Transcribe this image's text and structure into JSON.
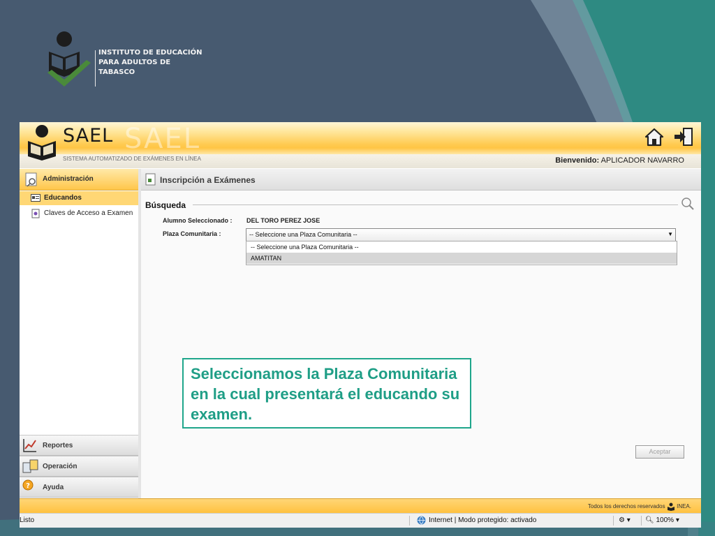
{
  "org": {
    "name_lines": [
      "INSTITUTO DE EDUCACIÓN",
      "PARA ADULTOS DE",
      "TABASCO"
    ]
  },
  "app": {
    "title": "SAEL",
    "subtitle": "SISTEMA AUTOMATIZADO DE EXÁMENES EN LÍNEA",
    "welcome_label": "Bienvenido:",
    "welcome_user": "APLICADOR NAVARRO",
    "icons": [
      "home-icon",
      "logout-icon"
    ]
  },
  "sidebar": {
    "section_title": "Administración",
    "items": [
      {
        "label": "Educandos",
        "active": true,
        "icon": "id-card-icon"
      },
      {
        "label": "Claves de Acceso a Examen",
        "active": false,
        "icon": "key-document-icon"
      }
    ],
    "accordions": [
      {
        "label": "Reportes",
        "icon": "chart-icon"
      },
      {
        "label": "Operación",
        "icon": "operations-icon"
      },
      {
        "label": "Ayuda",
        "icon": "help-icon"
      }
    ]
  },
  "main": {
    "panel_title": "Inscripción a Exámenes",
    "section_title": "Búsqueda",
    "fields": {
      "student_label": "Alumno Seleccionado :",
      "student_value": "DEL TORO PEREZ JOSE",
      "plaza_label": "Plaza Comunitaria :"
    },
    "plaza_select": {
      "selected": "-- Seleccione una Plaza Comunitaria --",
      "options": [
        "-- Seleccione una Plaza Comunitaria --",
        "AMATITAN"
      ],
      "highlighted_index": 1
    },
    "accept_label": "Aceptar"
  },
  "footer": {
    "rights": "Todos los derechos reservados",
    "brand": "INEA."
  },
  "statusbar": {
    "left": "Listo",
    "zone": "Internet | Modo protegido: activado",
    "zoom": "100%"
  },
  "callout": {
    "text": "Seleccionamos la Plaza Comunitaria en la cual presentará el educando  su examen."
  },
  "colors": {
    "slide_bg": "#475a70",
    "teal_shape": "#2e8a82",
    "accent_orange": "#ffc544",
    "logo_green": "#4a8a3a",
    "callout": "#1f9e86"
  }
}
